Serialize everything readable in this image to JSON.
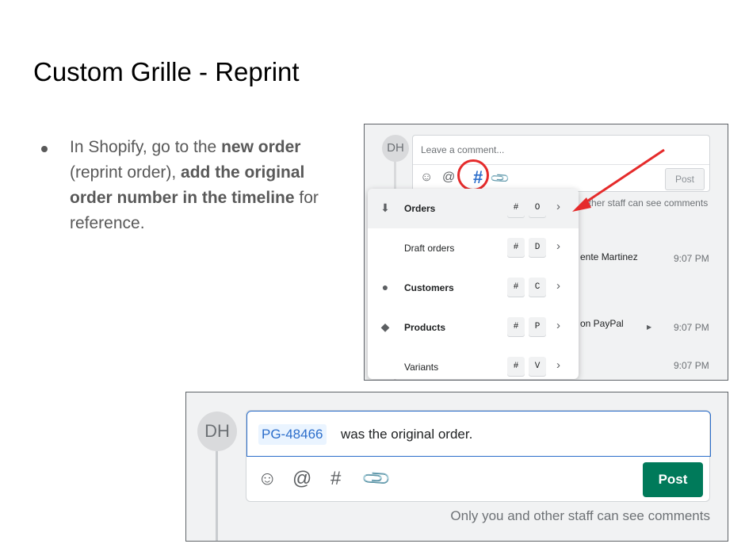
{
  "slide": {
    "title": "Custom Grille - Reprint",
    "bullet": {
      "part1": "In Shopify, go to the ",
      "bold1": "new order",
      "part2": " (reprint order), ",
      "bold2": "add the original order number in the timeline",
      "part3": " for reference."
    }
  },
  "top_screenshot": {
    "avatar_initials": "DH",
    "comment_placeholder": "Leave a comment...",
    "post_label": "Post",
    "icons": [
      "smiley-icon",
      "at-icon",
      "hash-icon",
      "paperclip-icon"
    ],
    "hash_glyph": "#",
    "visibility_note_partial": "other staff can see comments",
    "dropdown": [
      {
        "label": "Orders",
        "key1": "#",
        "key2": "O",
        "icon": "orders-icon",
        "active": true,
        "bold": true
      },
      {
        "label": "Draft orders",
        "key1": "#",
        "key2": "D",
        "icon": "",
        "active": false,
        "bold": false
      },
      {
        "label": "Customers",
        "key1": "#",
        "key2": "C",
        "icon": "customer-icon",
        "active": false,
        "bold": true
      },
      {
        "label": "Products",
        "key1": "#",
        "key2": "P",
        "icon": "tag-icon",
        "active": false,
        "bold": true
      },
      {
        "label": "Variants",
        "key1": "#",
        "key2": "V",
        "icon": "",
        "active": false,
        "bold": false
      }
    ],
    "timeline_rows": [
      {
        "text": "ente Martinez",
        "time": "9:07 PM"
      },
      {
        "text": "on PayPal",
        "time": "9:07 PM"
      },
      {
        "text": "",
        "time": "9:07 PM"
      }
    ],
    "annotation_color": "#e52b2b"
  },
  "bottom_screenshot": {
    "avatar_initials": "DH",
    "order_chip": "PG-48466",
    "comment_text": "was the original order.",
    "post_label": "Post",
    "post_color": "#007a5a",
    "visibility_note": "Only you and other staff can see comments",
    "icons": [
      "smiley-icon",
      "at-icon",
      "hash-icon",
      "paperclip-icon"
    ]
  }
}
